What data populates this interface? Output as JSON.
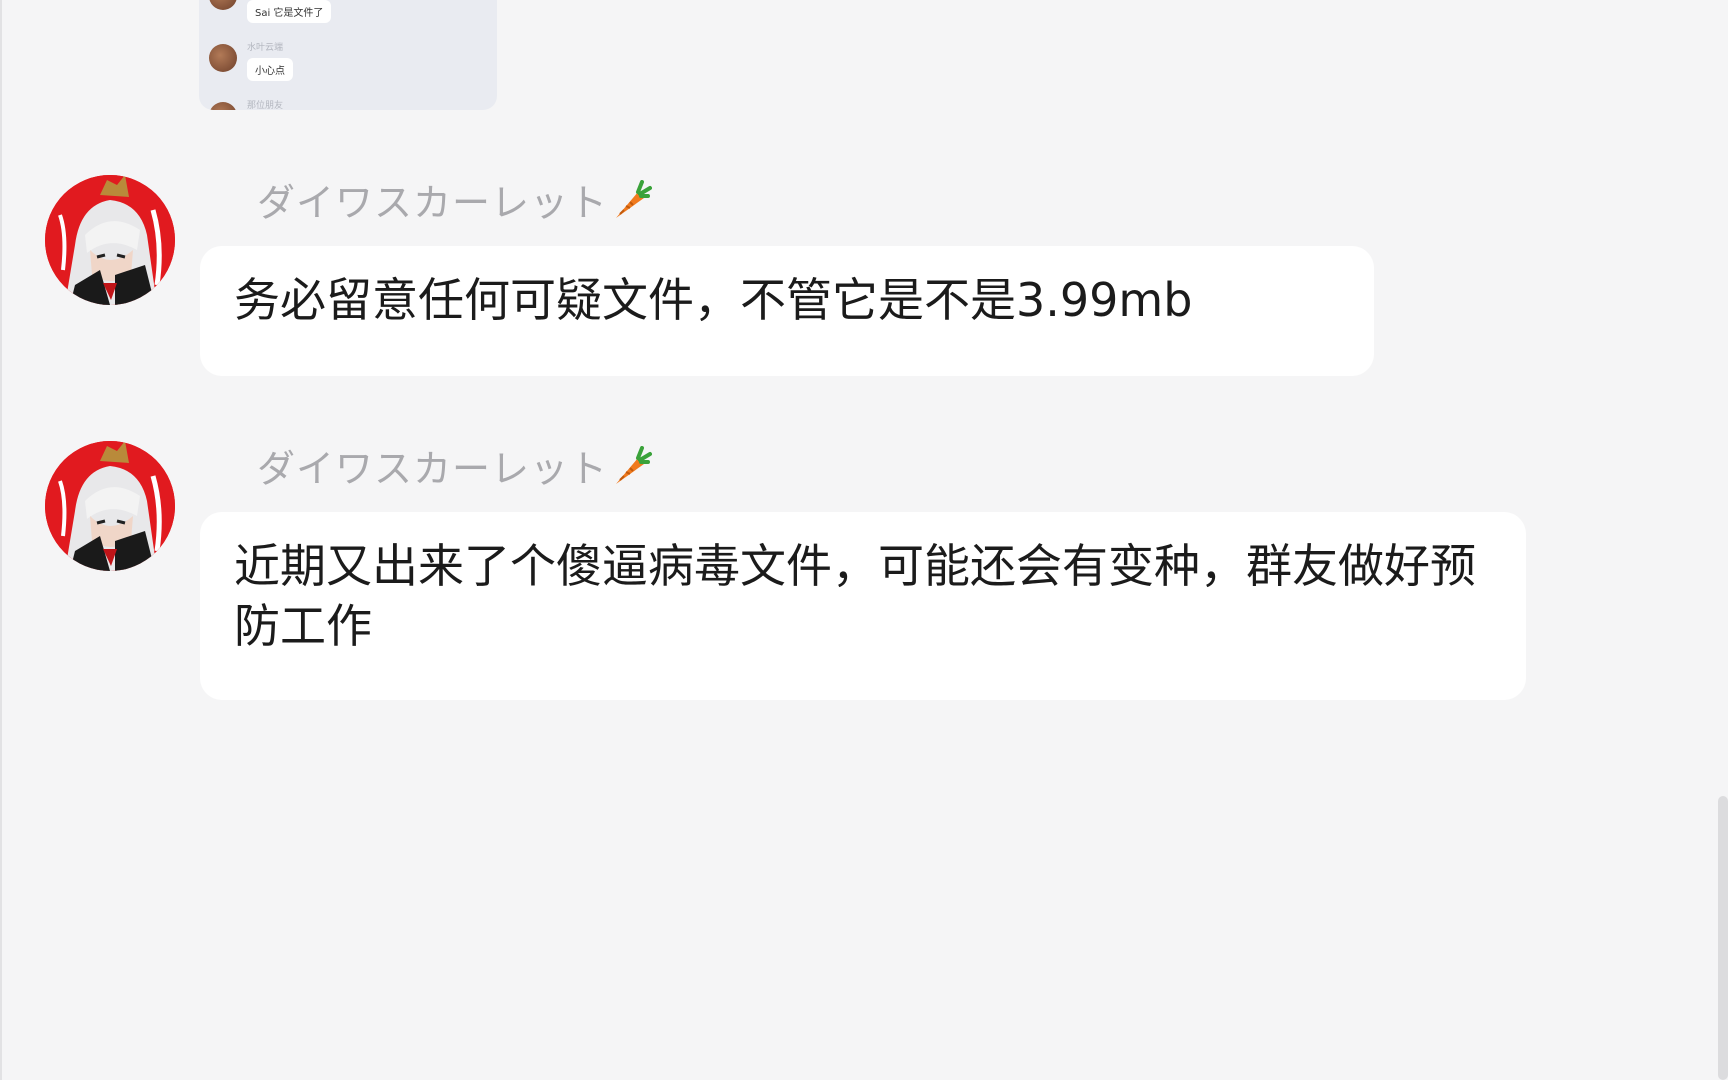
{
  "preview": {
    "rows": [
      {
        "name": "",
        "text": "Sai 它是文件了"
      },
      {
        "name": "水叶云端",
        "text": "小心点"
      },
      {
        "name": "那位朋友",
        "text": ""
      }
    ]
  },
  "messages": [
    {
      "sender": "ダイワスカーレット",
      "sender_icon": "carrot-icon",
      "text": "务必留意任何可疑文件，不管它是不是3.99mb"
    },
    {
      "sender": "ダイワスカーレット",
      "sender_icon": "carrot-icon",
      "text": "近期又出来了个傻逼病毒文件，可能还会有变种，群友做好预防工作"
    }
  ],
  "colors": {
    "background": "#f5f5f6",
    "bubble": "#ffffff",
    "sender_name": "#a9a9ad",
    "avatar_accent": "#e11a1f"
  }
}
